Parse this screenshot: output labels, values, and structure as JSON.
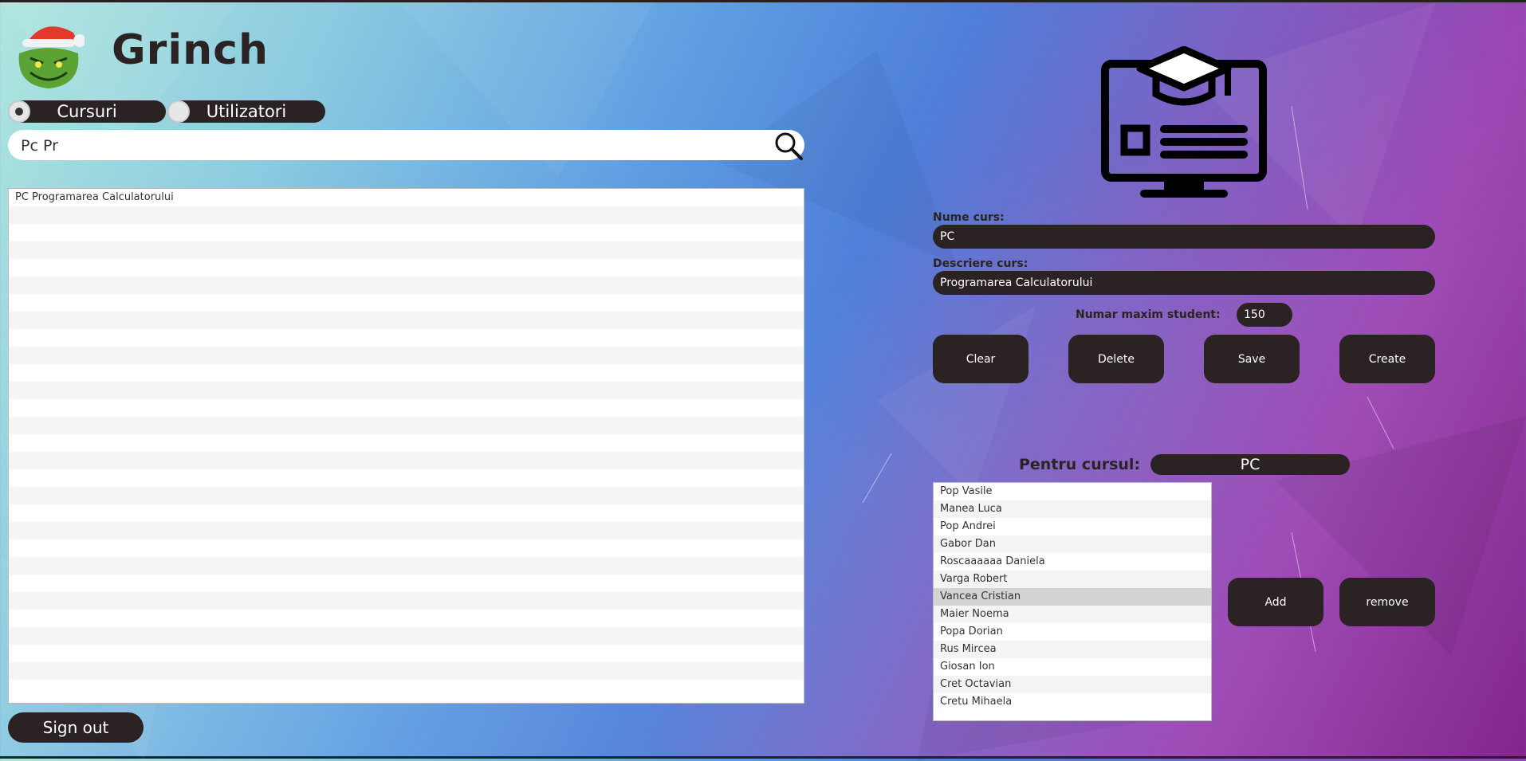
{
  "app": {
    "title": "Grinch"
  },
  "tabs": [
    {
      "label": "Cursuri",
      "selected": true
    },
    {
      "label": "Utilizatori",
      "selected": false
    }
  ],
  "search": {
    "value": "Pc Pr"
  },
  "courses": [
    "PC Programarea Calculatorului"
  ],
  "signout_label": "Sign out",
  "form": {
    "name_label": "Nume curs:",
    "name_value": "PC",
    "desc_label": "Descriere curs:",
    "desc_value": "Programarea Calculatorului",
    "max_label": "Numar maxim student:",
    "max_value": "150"
  },
  "buttons": {
    "clear": "Clear",
    "delete": "Delete",
    "save": "Save",
    "create": "Create"
  },
  "for_course": {
    "label": "Pentru cursul:",
    "value": "PC"
  },
  "students": [
    "Pop Vasile",
    "Manea Luca",
    "Pop Andrei",
    "Gabor Dan",
    "Roscaaaaaa Daniela",
    "Varga Robert",
    "Vancea Cristian",
    "Maier Noema",
    "Popa Dorian",
    "Rus Mircea",
    "Giosan Ion",
    "Cret Octavian",
    "Cretu Mihaela"
  ],
  "selected_student": "Vancea Cristian",
  "student_buttons": {
    "add": "Add",
    "remove": "remove"
  },
  "colors": {
    "dark": "#2b2323",
    "selection": "#d3d3d3"
  },
  "icons": {
    "search": "search-icon",
    "course": "course-monitor-icon",
    "logo": "grinch-logo"
  }
}
